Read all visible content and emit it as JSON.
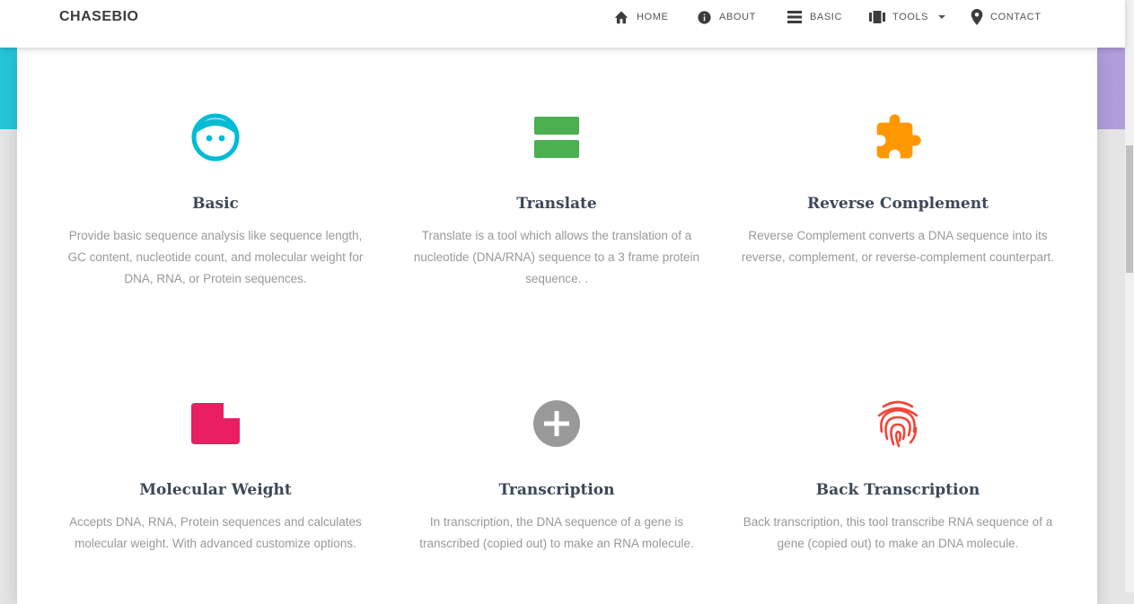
{
  "navbar": {
    "brand": "CHASEBIO",
    "items": [
      {
        "label": "HOME",
        "icon": "home-icon"
      },
      {
        "label": "ABOUT",
        "icon": "info-icon"
      },
      {
        "label": "BASIC",
        "icon": "list-icon"
      },
      {
        "label": "TOOLS",
        "icon": "view-array-icon"
      },
      {
        "label": "CONTACT",
        "icon": "location-pin-icon"
      }
    ]
  },
  "features": [
    {
      "title": "Basic",
      "description": "Provide basic sequence analysis like sequence length, GC content, nucleotide count, and molecular weight for DNA, RNA, or Protein sequences.",
      "icon": "face-icon",
      "color": "#00bcd4"
    },
    {
      "title": "Translate",
      "description": "Translate is a tool which allows the translation of a nucleotide (DNA/RNA) sequence to a 3 frame protein sequence. .",
      "icon": "view-agenda-icon",
      "color": "#4caf50"
    },
    {
      "title": "Reverse Complement",
      "description": "Reverse Complement converts a DNA sequence into its reverse, complement, or reverse-complement counterpart.",
      "icon": "puzzle-icon",
      "color": "#ff9800"
    },
    {
      "title": "Molecular Weight",
      "description": "Accepts DNA, RNA, Protein sequences and calculates molecular weight. With advanced customize options.",
      "icon": "note-icon",
      "color": "#e91e63"
    },
    {
      "title": "Transcription",
      "description": "In transcription, the DNA sequence of a gene is transcribed (copied out) to make an RNA molecule.",
      "icon": "add-circle-icon",
      "color": "#999999"
    },
    {
      "title": "Back Transcription",
      "description": "Back transcription, this tool transcribe RNA sequence of a gene (copied out) to make an DNA molecule.",
      "icon": "fingerprint-icon",
      "color": "#f44336"
    }
  ]
}
